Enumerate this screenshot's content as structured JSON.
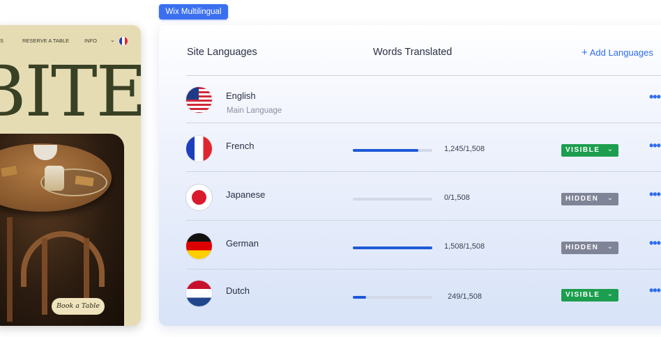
{
  "badge": {
    "label": "Wix Multilingual"
  },
  "site_preview": {
    "nav": {
      "fragment": "S",
      "reserve": "RESERVE A TABLE",
      "info": "INFO",
      "chevron": "⌄"
    },
    "logo": "BITE",
    "book_button": "Book a Table"
  },
  "panel": {
    "site_languages_header": "Site Languages",
    "words_translated_header": "Words Translated",
    "add_languages": {
      "plus": "+",
      "label": "Add Languages"
    },
    "more_icon_glyph": "•••",
    "dropdown_glyph": "⌄",
    "languages": [
      {
        "name": "English",
        "subtitle": "Main Language",
        "flag": "us-flag-icon"
      },
      {
        "name": "French",
        "progress": 0.826,
        "count": "1,245/1,508",
        "status": "VISIBLE",
        "status_color": "#1d9e4f",
        "flag": "france-flag-icon"
      },
      {
        "name": "Japanese",
        "progress": 0.0,
        "count": "0/1,508",
        "status": "HIDDEN",
        "status_color": "#7f8496",
        "flag": "japan-flag-icon"
      },
      {
        "name": "German",
        "progress": 1.0,
        "count": "1,508/1,508",
        "status": "HIDDEN",
        "status_color": "#7f8496",
        "flag": "germany-flag-icon"
      },
      {
        "name": "Dutch",
        "progress": 0.165,
        "count": "249/1,508",
        "status": "VISIBLE",
        "status_color": "#1d9e4f",
        "flag": "netherlands-flag-icon"
      }
    ]
  },
  "colors": {
    "accent": "#2e6cf0",
    "badge": "#3a6ff0",
    "progress_fill": "#1f5ad6"
  }
}
